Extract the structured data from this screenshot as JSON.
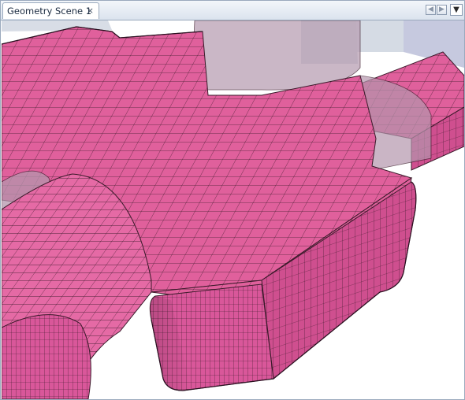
{
  "tab": {
    "title": "Geometry Scene 1",
    "close_glyph": "×"
  },
  "controls": {
    "prev_icon": "◀",
    "next_icon": "▶",
    "menu_icon": "▼"
  },
  "scene": {
    "mesh_color": "#e0609c",
    "mesh_dark": "#c44d85",
    "mesh_line": "#3a1a2a",
    "background_color": "#ffffff",
    "wall_color": "#d8dde6"
  }
}
